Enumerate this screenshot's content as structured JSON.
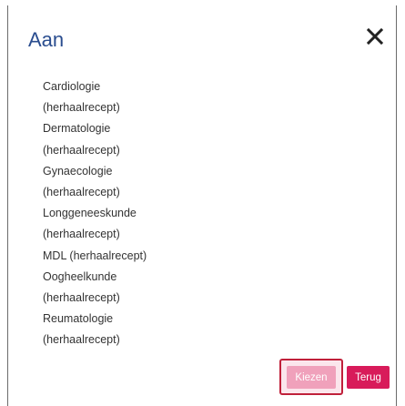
{
  "dialog": {
    "title": "Aan",
    "close_icon": "close-icon"
  },
  "options": [
    {
      "lines": [
        "Cardiologie",
        "(herhaalrecept)"
      ]
    },
    {
      "lines": [
        "Dermatologie",
        "(herhaalrecept)"
      ]
    },
    {
      "lines": [
        "Gynaecologie",
        "(herhaalrecept)"
      ]
    },
    {
      "lines": [
        "Longgeneeskunde",
        "(herhaalrecept)"
      ]
    },
    {
      "lines": [
        "MDL (herhaalrecept)"
      ]
    },
    {
      "lines": [
        "Oogheelkunde",
        "(herhaalrecept)"
      ]
    },
    {
      "lines": [
        "Reumatologie",
        "(herhaalrecept)"
      ]
    }
  ],
  "footer": {
    "choose_label": "Kiezen",
    "back_label": "Terug"
  },
  "colors": {
    "title": "#2a4d8f",
    "primary": "#d81b5a",
    "primary_disabled": "#f0a1bb",
    "focus_outline": "#c0203a"
  }
}
